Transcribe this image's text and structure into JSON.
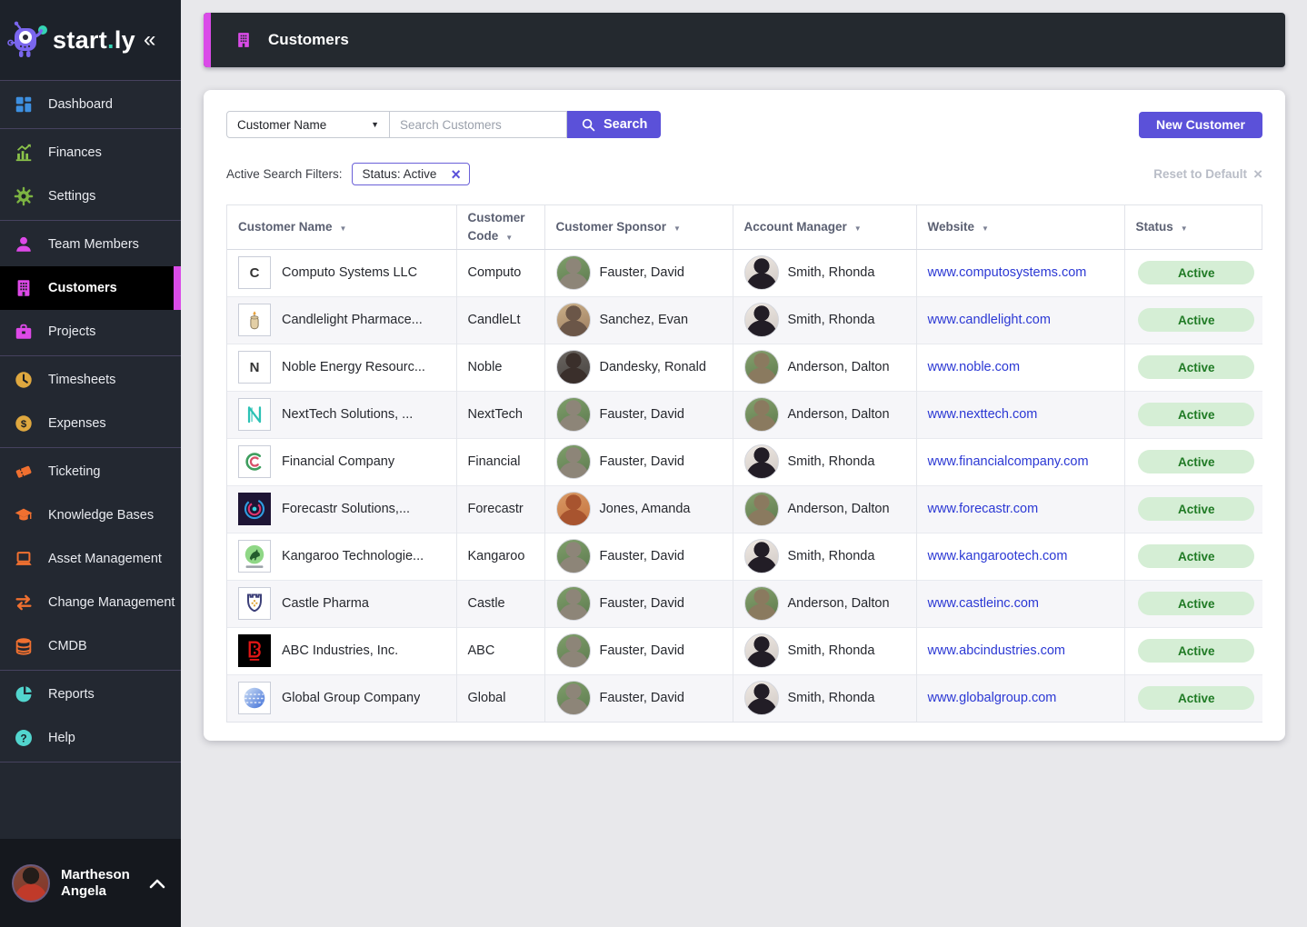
{
  "brand": {
    "part1": "start",
    "dot": ".",
    "part2": "ly",
    "collapse_icon": "«"
  },
  "sidebar": {
    "groups": [
      [
        {
          "label": "Dashboard",
          "icon": "dashboard-grid-icon",
          "color": "#3d8fe0"
        }
      ],
      [
        {
          "label": "Finances",
          "icon": "finances-chart-icon",
          "color": "#8bc34a"
        },
        {
          "label": "Settings",
          "icon": "settings-gear-icon",
          "color": "#7cb342"
        }
      ],
      [
        {
          "label": "Team Members",
          "icon": "team-members-icon",
          "color": "#de49e8"
        },
        {
          "label": "Customers",
          "icon": "customers-building-icon",
          "color": "#de49e8",
          "active": true
        },
        {
          "label": "Projects",
          "icon": "projects-briefcase-icon",
          "color": "#de49e8"
        }
      ],
      [
        {
          "label": "Timesheets",
          "icon": "timesheets-clock-icon",
          "color": "#dfa83f"
        },
        {
          "label": "Expenses",
          "icon": "expenses-coin-icon",
          "color": "#dfa83f"
        }
      ],
      [
        {
          "label": "Ticketing",
          "icon": "ticketing-ticket-icon",
          "color": "#f07030"
        },
        {
          "label": "Knowledge Bases",
          "icon": "knowledge-bases-cap-icon",
          "color": "#f07030"
        },
        {
          "label": "Asset Management",
          "icon": "asset-management-laptop-icon",
          "color": "#f07030"
        },
        {
          "label": "Change Management",
          "icon": "change-management-arrows-icon",
          "color": "#f07030"
        },
        {
          "label": "CMDB",
          "icon": "cmdb-database-icon",
          "color": "#f07030"
        }
      ],
      [
        {
          "label": "Reports",
          "icon": "reports-pie-icon",
          "color": "#52d5ce"
        },
        {
          "label": "Help",
          "icon": "help-question-icon",
          "color": "#52d5ce"
        }
      ]
    ],
    "user": {
      "name_line1": "Martheson",
      "name_line2": "Angela"
    }
  },
  "header": {
    "title": "Customers"
  },
  "toolbar": {
    "search_field_selector": "Customer Name",
    "search_placeholder": "Search Customers",
    "search_button": "Search",
    "new_customer_button": "New Customer"
  },
  "filters": {
    "label": "Active Search Filters:",
    "chip": "Status: Active",
    "reset": "Reset to Default"
  },
  "table": {
    "columns": [
      "Customer Name",
      "Customer Code",
      "Customer Sponsor",
      "Account Manager",
      "Website",
      "Status"
    ],
    "rows": [
      {
        "name": "Computo Systems LLC",
        "code": "Computo",
        "logo": {
          "kind": "letter",
          "text": "C"
        },
        "sponsor": "Fauster, David",
        "manager": "Smith, Rhonda",
        "website": "www.computosystems.com",
        "status": "Active"
      },
      {
        "name": "Candlelight Pharmace...",
        "code": "CandleLt",
        "logo": {
          "kind": "candle"
        },
        "sponsor": "Sanchez, Evan",
        "manager": "Smith, Rhonda",
        "website": "www.candlelight.com",
        "status": "Active"
      },
      {
        "name": "Noble Energy Resourc...",
        "code": "Noble",
        "logo": {
          "kind": "letter",
          "text": "N"
        },
        "sponsor": "Dandesky, Ronald",
        "manager": "Anderson, Dalton",
        "website": "www.noble.com",
        "status": "Active"
      },
      {
        "name": "NextTech Solutions, ...",
        "code": "NextTech",
        "logo": {
          "kind": "nexttech"
        },
        "sponsor": "Fauster, David",
        "manager": "Anderson, Dalton",
        "website": "www.nexttech.com",
        "status": "Active"
      },
      {
        "name": "Financial Company",
        "code": "Financial",
        "logo": {
          "kind": "coil"
        },
        "sponsor": "Fauster, David",
        "manager": "Smith, Rhonda",
        "website": "www.financialcompany.com",
        "status": "Active"
      },
      {
        "name": "Forecastr Solutions,...",
        "code": "Forecastr",
        "logo": {
          "kind": "forecastr"
        },
        "sponsor": "Jones, Amanda",
        "manager": "Anderson, Dalton",
        "website": "www.forecastr.com",
        "status": "Active"
      },
      {
        "name": "Kangaroo Technologie...",
        "code": "Kangaroo",
        "logo": {
          "kind": "kangaroo"
        },
        "sponsor": "Fauster, David",
        "manager": "Smith, Rhonda",
        "website": "www.kangarootech.com",
        "status": "Active"
      },
      {
        "name": "Castle Pharma",
        "code": "Castle",
        "logo": {
          "kind": "castle"
        },
        "sponsor": "Fauster, David",
        "manager": "Anderson, Dalton",
        "website": "www.castleinc.com",
        "status": "Active"
      },
      {
        "name": "ABC Industries, Inc.",
        "code": "ABC",
        "logo": {
          "kind": "abc"
        },
        "sponsor": "Fauster, David",
        "manager": "Smith, Rhonda",
        "website": "www.abcindustries.com",
        "status": "Active"
      },
      {
        "name": "Global Group Company",
        "code": "Global",
        "logo": {
          "kind": "globe"
        },
        "sponsor": "Fauster, David",
        "manager": "Smith, Rhonda",
        "website": "www.globalgroup.com",
        "status": "Active"
      }
    ]
  },
  "people": {
    "Fauster, David": {
      "silhouette": "#8d8578",
      "bg1": "#7f9e6a",
      "bg2": "#5c7a4f"
    },
    "Sanchez, Evan": {
      "silhouette": "#6b5648",
      "bg1": "#cbb089",
      "bg2": "#9b7b5e"
    },
    "Dandesky, Ronald": {
      "silhouette": "#3a2f2b",
      "bg1": "#6a6560",
      "bg2": "#474340"
    },
    "Jones, Amanda": {
      "silhouette": "#a8542f",
      "bg1": "#d99a66",
      "bg2": "#c4713c"
    },
    "Smith, Rhonda": {
      "silhouette": "#221d26",
      "bg1": "#efe9e3",
      "bg2": "#cfc8c4"
    },
    "Anderson, Dalton": {
      "silhouette": "#8a7a5f",
      "bg1": "#85a06d",
      "bg2": "#5d7a4d"
    }
  },
  "colors": {
    "accent_magenta": "#da4be8",
    "accent_purple": "#5b51d9",
    "link_blue": "#2b38d4",
    "status_active_bg": "#d5eed5",
    "status_active_text": "#1f7a24",
    "sidebar_bg": "#232831",
    "header_bar_bg": "#24292f"
  }
}
